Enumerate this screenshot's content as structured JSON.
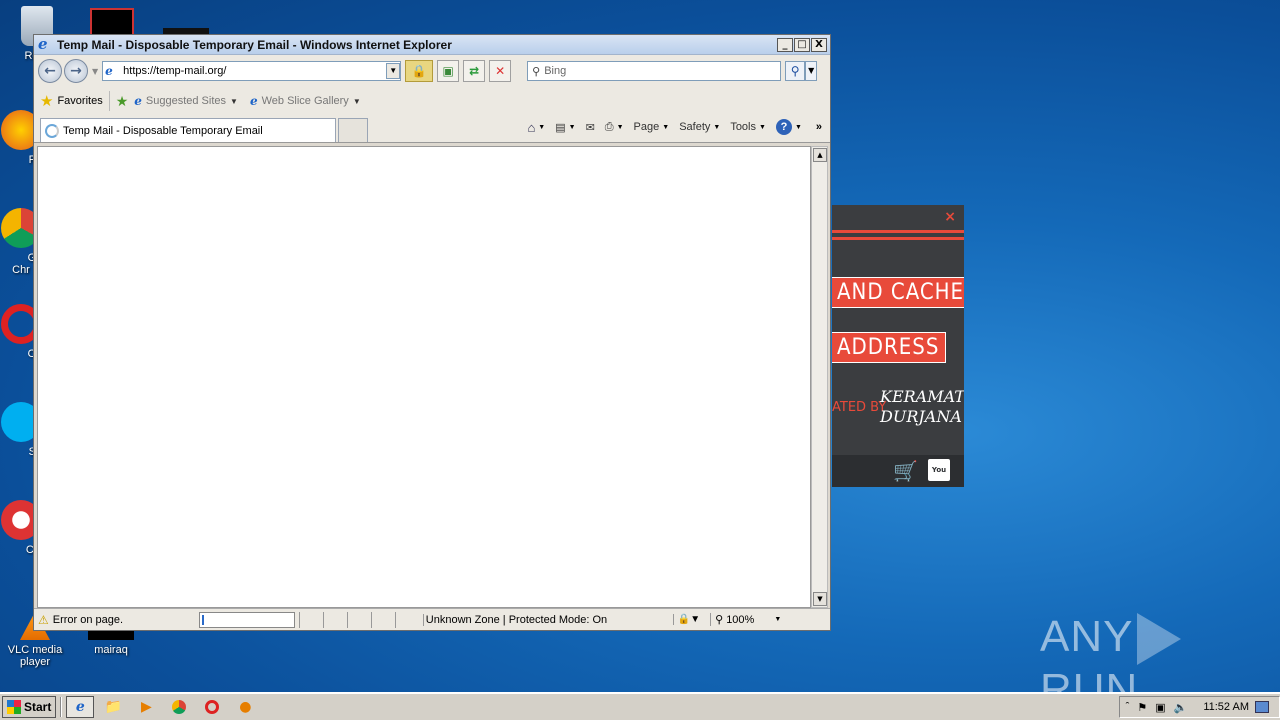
{
  "desktop": {
    "icons": [
      {
        "label": "Recy",
        "icon": "recycle-bin-icon"
      },
      {
        "label": "Fir",
        "icon": "firefox-icon"
      },
      {
        "label": "Go\nChr",
        "icon": "chrome-icon"
      },
      {
        "label": "Op",
        "icon": "opera-icon"
      },
      {
        "label": "Sk",
        "icon": "skype-icon"
      },
      {
        "label": "CCl",
        "icon": "ccleaner-icon"
      },
      {
        "label": "VLC media player",
        "icon": "vlc-icon"
      },
      {
        "label": "mairaq",
        "icon": "file-icon"
      }
    ]
  },
  "popup": {
    "close": "×",
    "btn1": "AND CACHE",
    "btn2": "ADDRESS",
    "created_by": "ATED BY",
    "author_line1": "KERAMAT",
    "author_line2": "DURJANA",
    "cart_icon": "cart-icon",
    "youtube_label": "You Tube"
  },
  "window": {
    "title": "Temp Mail - Disposable Temporary Email - Windows Internet Explorer",
    "min": "_",
    "max": "□",
    "close": "X",
    "back": "←",
    "forward": "→",
    "address": "https://temp-mail.org/",
    "search_placeholder": "Bing",
    "favorites": "Favorites",
    "suggested_sites": "Suggested Sites",
    "web_slice_gallery": "Web Slice Gallery",
    "tab_title": "Temp Mail - Disposable Temporary Email",
    "cmd": {
      "page": "Page",
      "safety": "Safety",
      "tools": "Tools",
      "help": "?"
    },
    "status": {
      "text": "Error on page.",
      "zone": "Unknown Zone | Protected Mode: On",
      "zoom": "100%"
    }
  },
  "taskbar": {
    "start": "Start",
    "clock": "11:52 AM"
  },
  "watermark": {
    "left": "ANY",
    "right": "RUN"
  }
}
